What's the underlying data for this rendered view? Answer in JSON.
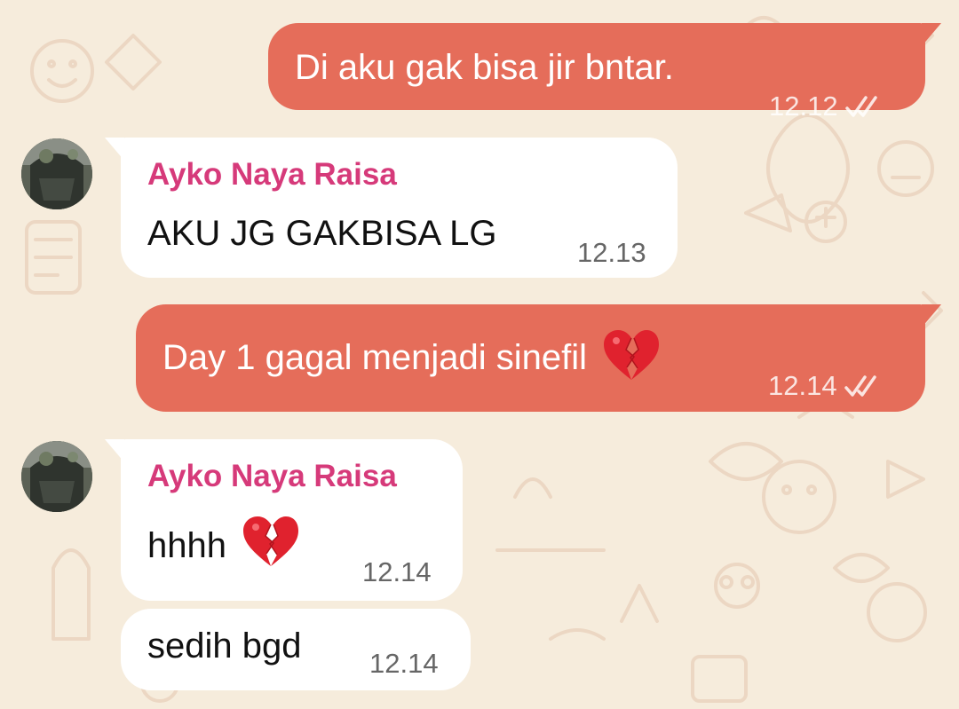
{
  "theme": {
    "wallpaper": "#f6ecdc",
    "outgoing_bubble": "#e56d5a",
    "incoming_bubble": "#ffffff",
    "sender_name_color": "#d63a7a"
  },
  "messages": [
    {
      "direction": "outgoing",
      "text": "Di aku gak bisa jir bntar.",
      "time": "12.12",
      "status": "read-ticks"
    },
    {
      "direction": "incoming",
      "sender": "Ayko Naya Raisa",
      "text": "AKU JG GAKBISA LG",
      "time": "12.13"
    },
    {
      "direction": "outgoing",
      "text": "Day 1 gagal menjadi sinefil",
      "emoji": "broken-heart",
      "time": "12.14",
      "status": "read-ticks"
    },
    {
      "direction": "incoming",
      "sender": "Ayko Naya Raisa",
      "text": "hhhh",
      "emoji": "broken-heart",
      "time": "12.14"
    },
    {
      "direction": "incoming",
      "text": "sedih bgd",
      "time": "12.14"
    }
  ]
}
